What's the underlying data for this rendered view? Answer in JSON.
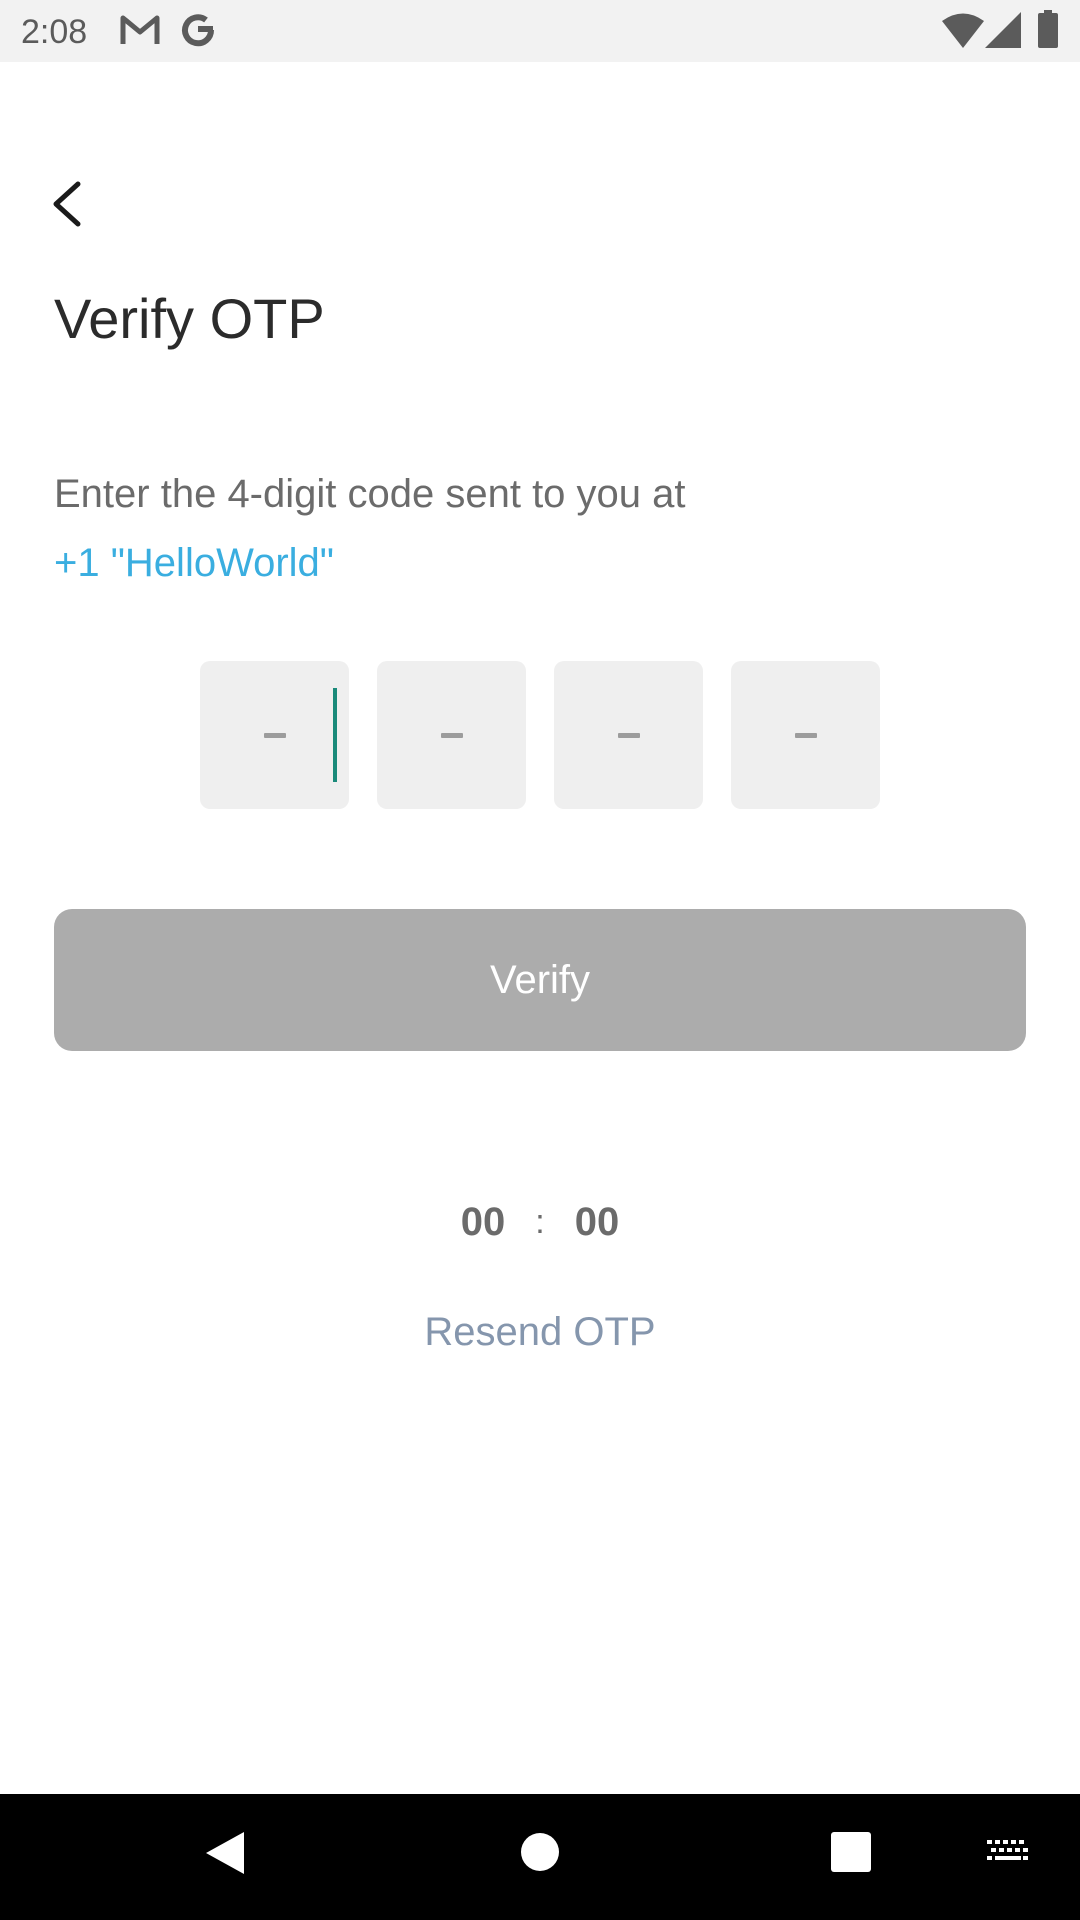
{
  "status_bar": {
    "time": "2:08",
    "icons": [
      "gmail-icon",
      "google-icon",
      "wifi-icon",
      "signal-icon",
      "battery-icon"
    ]
  },
  "header": {
    "back_icon": "chevron-left-icon",
    "title": "Verify OTP"
  },
  "instructions": {
    "text": "Enter the 4-digit code sent to you at",
    "phone": "+1 \"HelloWorld\""
  },
  "otp": {
    "digit_count": 4,
    "values": [
      "",
      "",
      "",
      ""
    ],
    "focused_index": 0,
    "caret_color": "#1a8a7a",
    "box_color": "#efefef"
  },
  "verify_button": {
    "label": "Verify",
    "enabled": false,
    "background": "#acacac"
  },
  "timer": {
    "minutes": "00",
    "separator": ":",
    "seconds": "00"
  },
  "resend": {
    "label": "Resend OTP",
    "color": "#8596ad"
  },
  "nav_bar": {
    "items": [
      "back-triangle-icon",
      "home-circle-icon",
      "recents-square-icon",
      "keyboard-icon"
    ]
  },
  "colors": {
    "accent_link": "#3aaee0",
    "title_text": "#2b2b2b",
    "body_text": "#6b6b6b"
  }
}
